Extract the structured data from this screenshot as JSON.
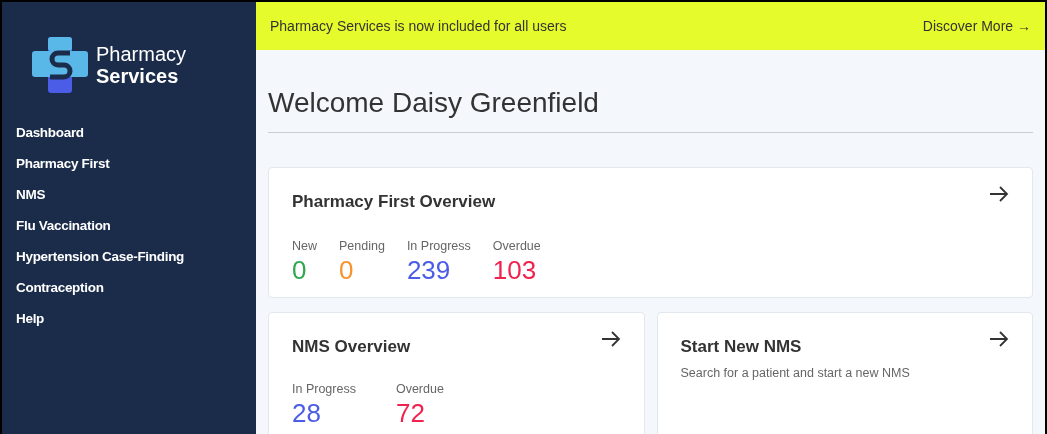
{
  "logo": {
    "line_1": "Pharmacy",
    "line_2": "Services"
  },
  "sidebar": {
    "items": [
      {
        "label": "Dashboard"
      },
      {
        "label": "Pharmacy First"
      },
      {
        "label": "NMS"
      },
      {
        "label": "Flu Vaccination"
      },
      {
        "label": "Hypertension Case-Finding"
      },
      {
        "label": "Contraception"
      },
      {
        "label": "Help"
      }
    ]
  },
  "banner": {
    "message": "Pharmacy Services is now included for all users",
    "link": "Discover More →"
  },
  "heading": "Welcome Daisy Greenfield",
  "cards": [
    {
      "title": "Pharmacy First Overview",
      "stats": [
        {
          "label": "New",
          "value": "0",
          "color": "#2fa84f"
        },
        {
          "label": "Pending",
          "value": "0",
          "color": "#f7932b"
        },
        {
          "label": "In Progress",
          "value": "239",
          "color": "#4b5ce6"
        },
        {
          "label": "Overdue",
          "value": "103",
          "color": "#f0234f"
        }
      ]
    },
    {
      "title": "NMS Overview",
      "stats": [
        {
          "label": "In Progress",
          "value": "28",
          "color": "#4b5ce6"
        },
        {
          "label": "Overdue",
          "value": "72",
          "color": "#f0234f"
        }
      ]
    },
    {
      "title": "Start New NMS",
      "description": "Search for a patient and start a new NMS"
    }
  ]
}
